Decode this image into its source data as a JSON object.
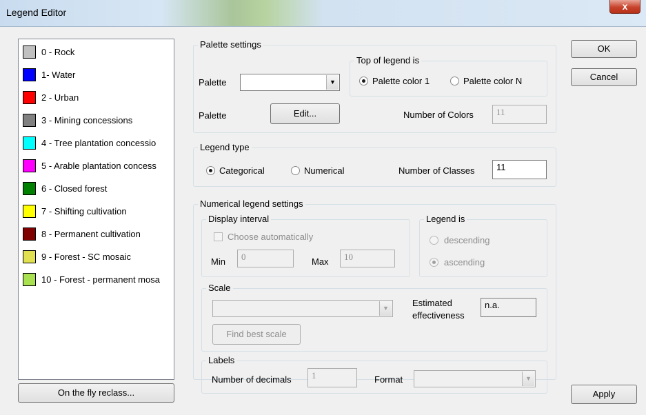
{
  "window": {
    "title": "Legend Editor",
    "close_glyph": "x"
  },
  "legend_items": [
    {
      "label": "0 - Rock",
      "color": "#c0c0c0"
    },
    {
      "label": "1- Water",
      "color": "#0000ff"
    },
    {
      "label": "2 - Urban",
      "color": "#ff0000"
    },
    {
      "label": "3 - Mining concessions",
      "color": "#808080"
    },
    {
      "label": "4 - Tree plantation concessio",
      "color": "#00ffff"
    },
    {
      "label": "5 - Arable plantation concess",
      "color": "#ff00ff"
    },
    {
      "label": "6 - Closed forest",
      "color": "#008000"
    },
    {
      "label": "7 - Shifting cultivation",
      "color": "#ffff00"
    },
    {
      "label": "8 - Permanent cultivation",
      "color": "#800000"
    },
    {
      "label": "9 - Forest - SC mosaic",
      "color": "#e0e050"
    },
    {
      "label": "10 - Forest - permanent mosa",
      "color": "#a8e050"
    }
  ],
  "reclass_button": "On the fly reclass...",
  "buttons": {
    "ok": "OK",
    "cancel": "Cancel",
    "apply": "Apply"
  },
  "palette_settings": {
    "title": "Palette settings",
    "palette_label": "Palette",
    "palette_value": "",
    "palette_label_2": "Palette",
    "edit_button": "Edit...",
    "top_of_legend": {
      "title": "Top of legend is",
      "option1": "Palette color 1",
      "option2": "Palette color N",
      "selected": "Palette color 1"
    },
    "number_of_colors_label": "Number of Colors",
    "number_of_colors_value": "11"
  },
  "legend_type": {
    "title": "Legend type",
    "option1": "Categorical",
    "option2": "Numerical",
    "selected": "Categorical",
    "number_of_classes_label": "Number of Classes",
    "number_of_classes_value": "11"
  },
  "numerical_settings": {
    "title": "Numerical legend settings",
    "display_interval": {
      "title": "Display interval",
      "choose_auto": "Choose automatically",
      "min_label": "Min",
      "min_value": "0",
      "max_label": "Max",
      "max_value": "10"
    },
    "legend_is": {
      "title": "Legend is",
      "option1": "descending",
      "option2": "ascending",
      "selected": "ascending"
    },
    "scale": {
      "title": "Scale",
      "value": "",
      "estimated_label_1": "Estimated",
      "estimated_label_2": "effectiveness",
      "estimated_value": "n.a.",
      "find_best": "Find best scale"
    },
    "labels": {
      "title": "Labels",
      "decimals_label": "Number of decimals",
      "decimals_value": "1",
      "format_label": "Format",
      "format_value": ""
    }
  }
}
